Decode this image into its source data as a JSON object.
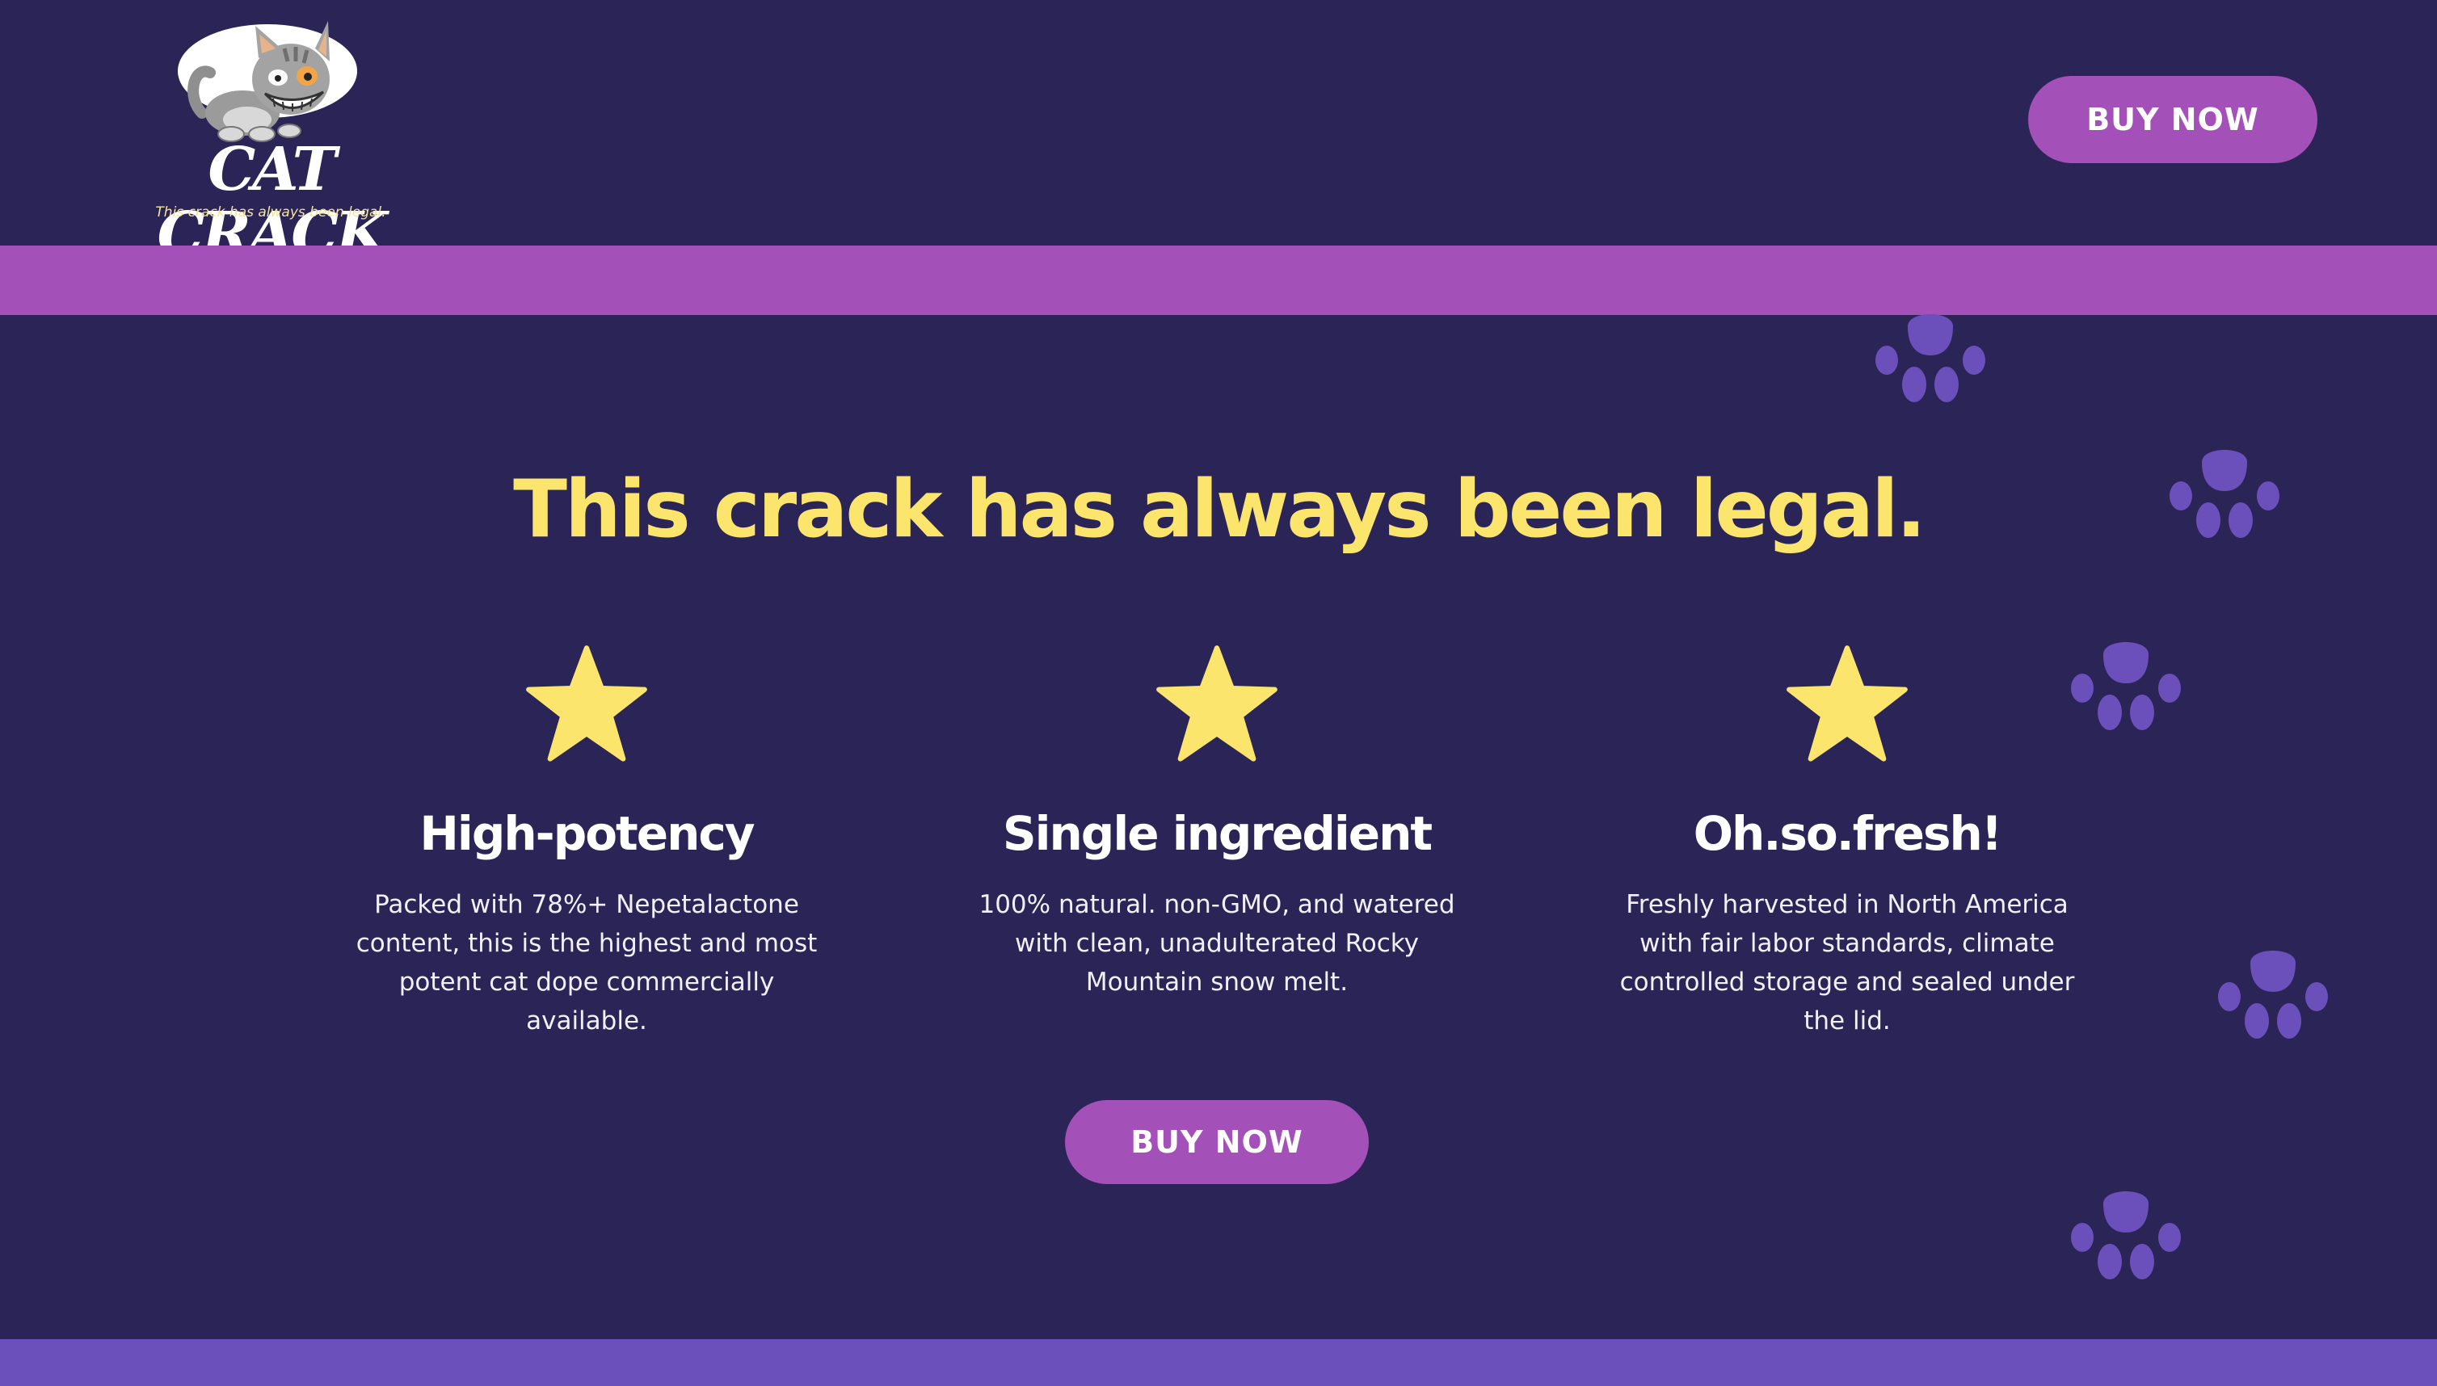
{
  "header": {
    "logo": {
      "wordmark": "CAT CRACK",
      "tagline": "This crack has always been legal.",
      "icon": "cat-mascot-icon"
    },
    "buy_button_label": "BUY NOW"
  },
  "hero": {
    "headline": "This crack has always been legal."
  },
  "features": [
    {
      "icon": "star-icon",
      "title": "High-potency",
      "description": "Packed with 78%+ Nepetalactone content, this is the highest and most potent cat dope commercially available."
    },
    {
      "icon": "star-icon",
      "title": "Single ingredient",
      "description": "100% natural. non-GMO, and watered with clean, unadulterated Rocky Mountain snow melt."
    },
    {
      "icon": "star-icon",
      "title": "Oh.so.fresh!",
      "description": "Freshly harvested in North America with fair labor standards, climate controlled storage and sealed under the lid."
    }
  ],
  "cta": {
    "buy_button_label": "BUY NOW"
  },
  "colors": {
    "background": "#2b2456",
    "accent_purple": "#a350b9",
    "headline_yellow": "#fbe56d",
    "paw_purple": "#6b4fbb",
    "footer_band": "#6b4fbb"
  },
  "decorations": {
    "paw_icon": "paw-print-icon"
  }
}
